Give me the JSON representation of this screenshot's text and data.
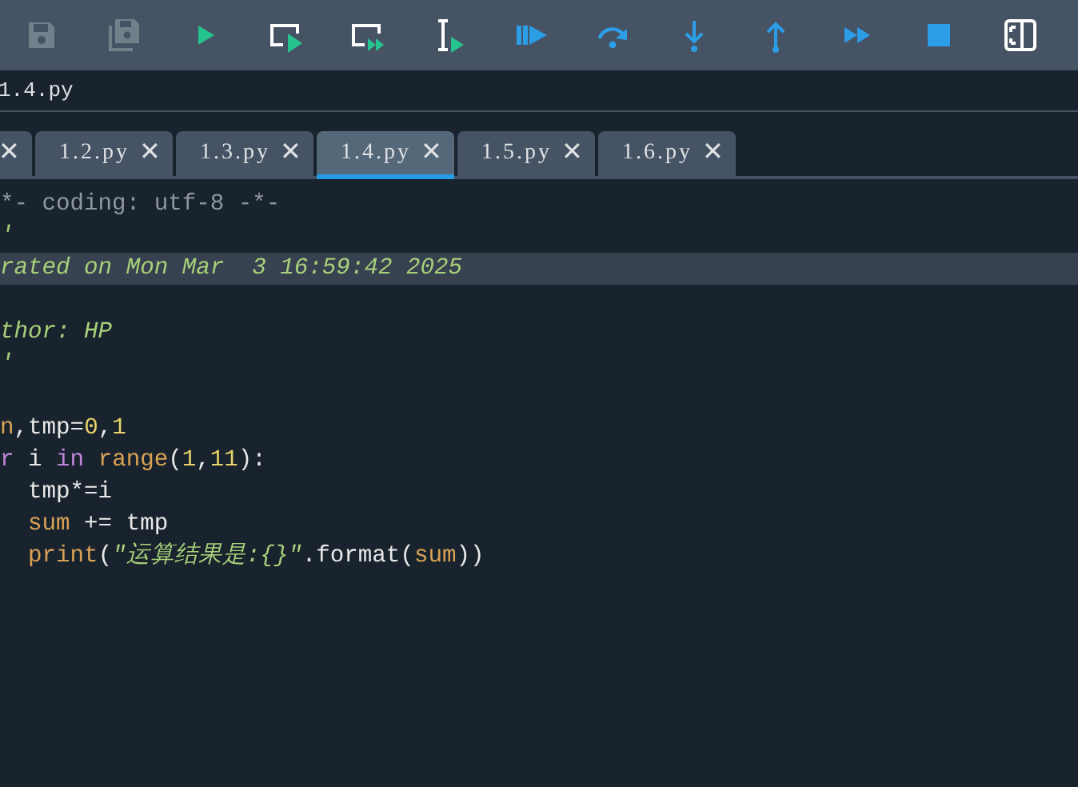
{
  "toolbar": [
    {
      "kind": "save",
      "disabled": true
    },
    {
      "kind": "save-all",
      "disabled": true
    },
    {
      "kind": "run",
      "disabled": false
    },
    {
      "kind": "run-cell",
      "disabled": false
    },
    {
      "kind": "run-cell-advance",
      "disabled": false
    },
    {
      "kind": "run-selection",
      "disabled": false
    },
    {
      "kind": "debug",
      "disabled": false
    },
    {
      "kind": "step-over",
      "disabled": false
    },
    {
      "kind": "step-into",
      "disabled": false
    },
    {
      "kind": "step-out",
      "disabled": false
    },
    {
      "kind": "continue",
      "disabled": false
    },
    {
      "kind": "stop",
      "disabled": false
    },
    {
      "kind": "panel",
      "disabled": false
    }
  ],
  "path": "1.4.py",
  "tabs": [
    {
      "close": "✕",
      "selected": false
    },
    {
      "label": "1.2.py",
      "close": "✕",
      "selected": false
    },
    {
      "label": "1.3.py",
      "close": "✕",
      "selected": false
    },
    {
      "label": "1.4.py",
      "close": "✕",
      "selected": true
    },
    {
      "label": "1.5.py",
      "close": "✕",
      "selected": false
    },
    {
      "label": "1.6.py",
      "close": "✕",
      "selected": false
    }
  ],
  "code": [
    {
      "highlighted": false,
      "tokens": [
        {
          "kind": "comment",
          "text": "*- coding: utf-8 -*-"
        }
      ]
    },
    {
      "highlighted": false,
      "tokens": [
        {
          "kind": "docstring",
          "text": "'"
        }
      ]
    },
    {
      "highlighted": true,
      "tokens": [
        {
          "kind": "docstring",
          "text": "rated on Mon Mar  3 16:59:42 2025"
        }
      ]
    },
    {
      "highlighted": false
    },
    {
      "highlighted": false,
      "tokens": [
        {
          "kind": "docstring",
          "text": "thor: HP"
        }
      ]
    },
    {
      "highlighted": false,
      "tokens": [
        {
          "kind": "docstring",
          "text": "'"
        }
      ]
    },
    {
      "highlighted": false
    },
    {
      "highlighted": false,
      "tokens": [
        {
          "kind": "builtin",
          "text": "n"
        },
        {
          "kind": "plain",
          "text": ",tmp="
        },
        {
          "kind": "number",
          "text": "0"
        },
        {
          "kind": "plain",
          "text": ","
        },
        {
          "kind": "number",
          "text": "1"
        }
      ]
    },
    {
      "highlighted": false,
      "tokens": [
        {
          "kind": "keyword",
          "text": "r"
        },
        {
          "kind": "plain",
          "text": " i "
        },
        {
          "kind": "keyword",
          "text": "in"
        },
        {
          "kind": "builtin",
          "text": " range"
        },
        {
          "kind": "plain",
          "text": "("
        },
        {
          "kind": "number",
          "text": "1"
        },
        {
          "kind": "plain",
          "text": ","
        },
        {
          "kind": "number",
          "text": "11"
        },
        {
          "kind": "plain",
          "text": "):"
        }
      ]
    },
    {
      "highlighted": false,
      "tokens": [
        {
          "kind": "plain",
          "text": "  tmp*=i"
        }
      ]
    },
    {
      "highlighted": false,
      "tokens": [
        {
          "kind": "builtin",
          "text": "  sum"
        },
        {
          "kind": "plain",
          "text": " += tmp"
        }
      ]
    },
    {
      "highlighted": false,
      "tokens": [
        {
          "kind": "builtin",
          "text": "  print"
        },
        {
          "kind": "plain",
          "text": "("
        },
        {
          "kind": "string",
          "text": "\"运算结果是:{}\""
        },
        {
          "kind": "plain",
          "text": ".format("
        },
        {
          "kind": "builtin",
          "text": "sum"
        },
        {
          "kind": "plain",
          "text": "))"
        }
      ]
    }
  ]
}
